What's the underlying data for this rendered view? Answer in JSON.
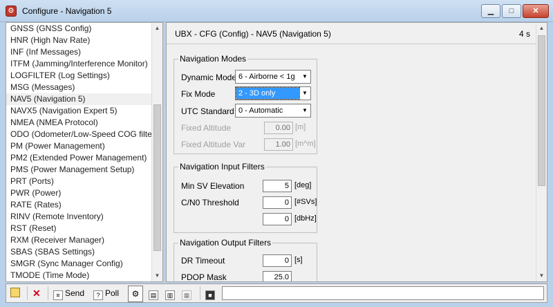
{
  "window": {
    "title": "Configure - Navigation 5"
  },
  "sidebar": {
    "items": [
      {
        "label": "GNSS (GNSS Config)",
        "selected": false
      },
      {
        "label": "HNR (High Nav Rate)",
        "selected": false
      },
      {
        "label": "INF (Inf Messages)",
        "selected": false
      },
      {
        "label": "ITFM (Jamming/Interference Monitor)",
        "selected": false
      },
      {
        "label": "LOGFILTER (Log Settings)",
        "selected": false
      },
      {
        "label": "MSG (Messages)",
        "selected": false
      },
      {
        "label": "NAV5 (Navigation 5)",
        "selected": true
      },
      {
        "label": "NAVX5 (Navigation Expert 5)",
        "selected": false
      },
      {
        "label": "NMEA (NMEA Protocol)",
        "selected": false
      },
      {
        "label": "ODO (Odometer/Low-Speed COG filter)",
        "selected": false
      },
      {
        "label": "PM (Power Management)",
        "selected": false
      },
      {
        "label": "PM2 (Extended Power Management)",
        "selected": false
      },
      {
        "label": "PMS (Power Management Setup)",
        "selected": false
      },
      {
        "label": "PRT (Ports)",
        "selected": false
      },
      {
        "label": "PWR (Power)",
        "selected": false
      },
      {
        "label": "RATE (Rates)",
        "selected": false
      },
      {
        "label": "RINV (Remote Inventory)",
        "selected": false
      },
      {
        "label": "RST (Reset)",
        "selected": false
      },
      {
        "label": "RXM (Receiver Manager)",
        "selected": false
      },
      {
        "label": "SBAS (SBAS Settings)",
        "selected": false
      },
      {
        "label": "SMGR (Sync Manager Config)",
        "selected": false
      },
      {
        "label": "TMODE (Time Mode)",
        "selected": false
      }
    ]
  },
  "panel": {
    "title": "UBX - CFG (Config) - NAV5 (Navigation 5)",
    "rate": "4 s"
  },
  "nav_modes": {
    "title": "Navigation Modes",
    "dynamic_model": {
      "label": "Dynamic Model",
      "value": "6 - Airborne < 1g"
    },
    "fix_mode": {
      "label": "Fix Mode",
      "value": "2 - 3D only"
    },
    "utc_standard": {
      "label": "UTC Standard",
      "value": "0 - Automatic"
    },
    "fixed_altitude": {
      "label": "Fixed Altitude",
      "value": "0.00",
      "unit": "[m]"
    },
    "fixed_altitude_var": {
      "label": "Fixed Altitude Var",
      "value": "1.00",
      "unit": "[m^m]"
    }
  },
  "input_filters": {
    "title": "Navigation Input Filters",
    "min_sv_elevation": {
      "label": "Min SV Elevation",
      "value": "5",
      "unit": "[deg]"
    },
    "cno_threshold": {
      "label": "C/N0 Threshold",
      "value": "0",
      "unit": "[#SVs]"
    },
    "cno_threshold_dbhz": {
      "value": "0",
      "unit": "[dbHz]"
    }
  },
  "output_filters": {
    "title": "Navigation Output Filters",
    "dr_timeout": {
      "label": "DR Timeout",
      "value": "0",
      "unit": "[s]"
    },
    "pdop_mask": {
      "label": "PDOP Mask",
      "value": "25.0"
    }
  },
  "toolbar": {
    "send_label": "Send",
    "poll_label": "Poll"
  },
  "icons": {
    "app": "u-center-app-icon",
    "lock": "lock-icon",
    "close": "red-x-icon",
    "send": "send-icon",
    "poll": "poll-icon"
  },
  "colors": {
    "titlebar": "#b9d1ea",
    "selection": "#3399ff",
    "close_button": "#c7432c"
  }
}
